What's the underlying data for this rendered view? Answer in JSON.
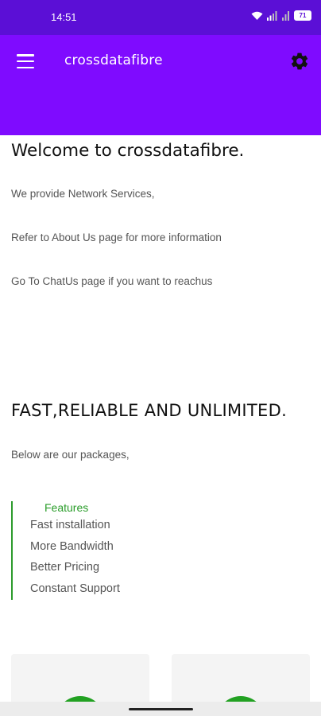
{
  "status_bar": {
    "time": "14:51",
    "battery_level": "71"
  },
  "app_bar": {
    "title": "crossdatafibre",
    "background_color": "#7f0bff",
    "menu_icon": "hamburger-menu-icon",
    "settings_icon": "gear-icon"
  },
  "welcome": {
    "heading": "Welcome to crossdatafibre.",
    "lines": [
      "We provide Network Services,",
      "Refer to About Us page for more information",
      "Go To ChatUs page if you want to reachus"
    ]
  },
  "packages": {
    "heading": "FAST,RELIABLE AND UNLIMITED.",
    "intro": "Below are our packages,"
  },
  "features": {
    "title": "Features",
    "accent_color": "#2c9b2c",
    "items": [
      "Fast installation",
      "More Bandwidth",
      "Better Pricing",
      "Constant Support"
    ]
  }
}
